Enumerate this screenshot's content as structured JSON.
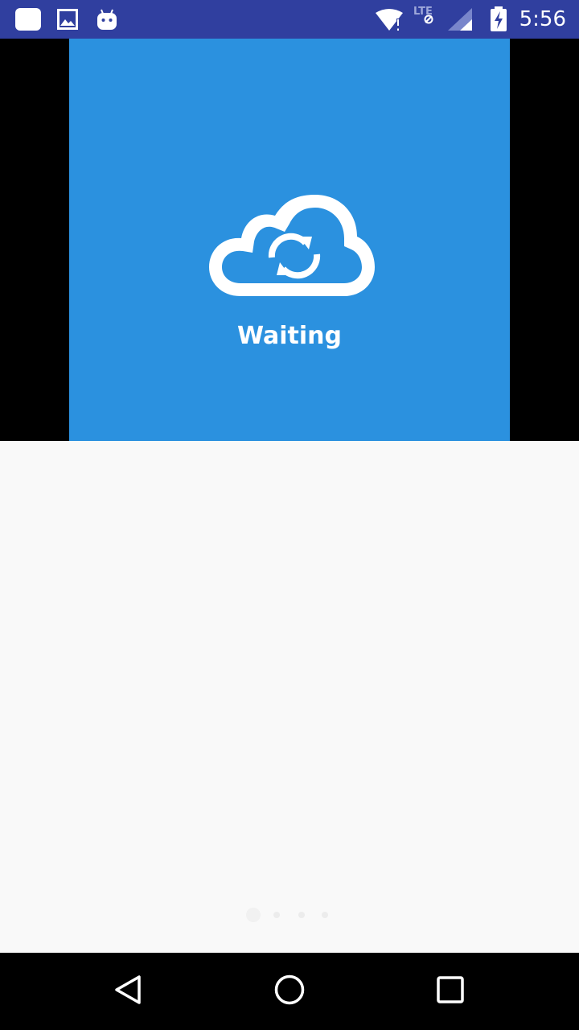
{
  "status_bar": {
    "time": "5:56",
    "network_label": "LTE",
    "icons": [
      "notification-square-icon",
      "image-icon",
      "android-robot-icon",
      "wifi-alert-icon",
      "lte-signal-icon",
      "cell-signal-icon",
      "battery-charging-icon"
    ]
  },
  "hero": {
    "status_text": "Waiting",
    "icon": "cloud-sync-icon",
    "panel_color": "#2b91df"
  },
  "pager": {
    "count": 4,
    "active_index": 0
  },
  "nav_bar": {
    "icons": [
      "back-triangle-icon",
      "home-circle-icon",
      "recents-square-icon"
    ]
  },
  "colors": {
    "status_bar": "#303f9f",
    "background": "#f9f9f9",
    "accent": "#2b91df"
  }
}
